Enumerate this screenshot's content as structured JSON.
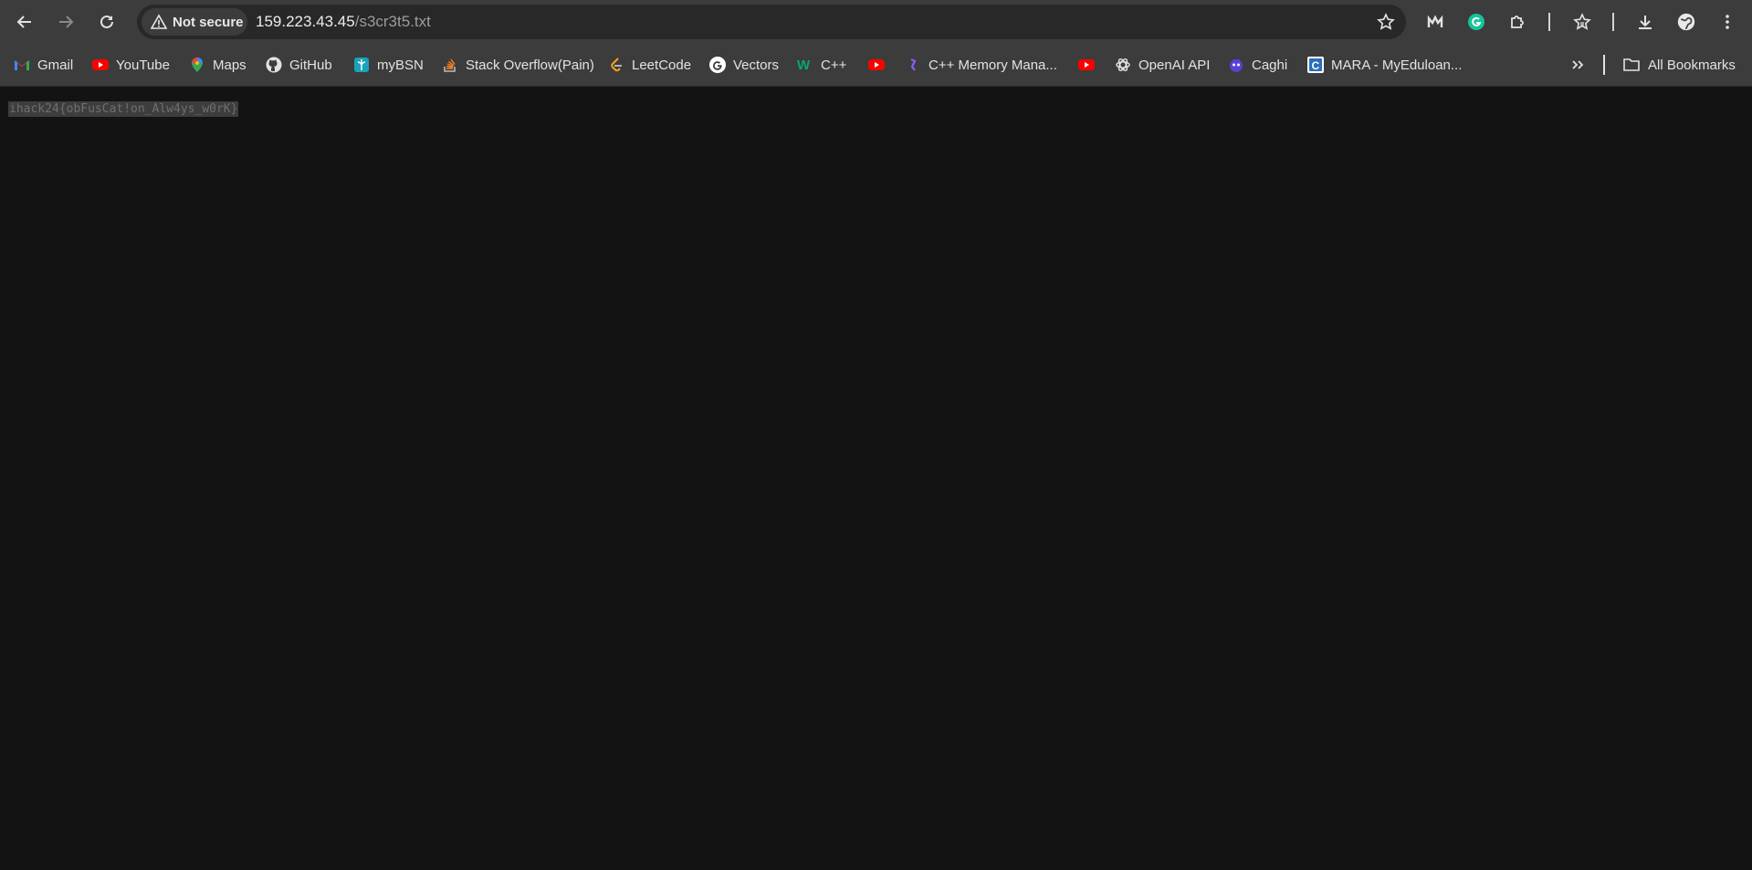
{
  "address_bar": {
    "security_label": "Not secure",
    "url_host": "159.223.43.45",
    "url_path": "/s3cr3t5.txt"
  },
  "bookmarks": {
    "items": [
      {
        "label": "Gmail",
        "icon": "gmail-icon"
      },
      {
        "label": "YouTube",
        "icon": "youtube-icon"
      },
      {
        "label": "Maps",
        "icon": "maps-icon"
      },
      {
        "label": "GitHub",
        "icon": "github-icon"
      },
      {
        "label": "myBSN",
        "icon": "mybsn-icon"
      },
      {
        "label": "Stack Overflow(Pain)",
        "icon": "stackoverflow-icon"
      },
      {
        "label": "LeetCode",
        "icon": "leetcode-icon"
      },
      {
        "label": "Vectors",
        "icon": "google-icon"
      },
      {
        "label": "C++",
        "icon": "w3schools-icon"
      },
      {
        "label": "",
        "icon": "youtube-icon"
      },
      {
        "label": "C++ Memory Mana...",
        "icon": "site-icon"
      },
      {
        "label": "",
        "icon": "youtube-icon"
      },
      {
        "label": "OpenAI API",
        "icon": "openai-icon"
      },
      {
        "label": "Caghi",
        "icon": "caghi-icon"
      },
      {
        "label": "MARA - MyEduloan...",
        "icon": "mara-icon"
      }
    ],
    "all_bookmarks_label": "All Bookmarks"
  },
  "page": {
    "content_text": "ihack24{obFusCat!on_Alw4ys_w0rK}"
  },
  "colors": {
    "toolbar_bg": "#3c3c3c",
    "page_bg": "#131313",
    "selection_bg": "#3d3d3d",
    "youtube_red": "#ff0000"
  }
}
